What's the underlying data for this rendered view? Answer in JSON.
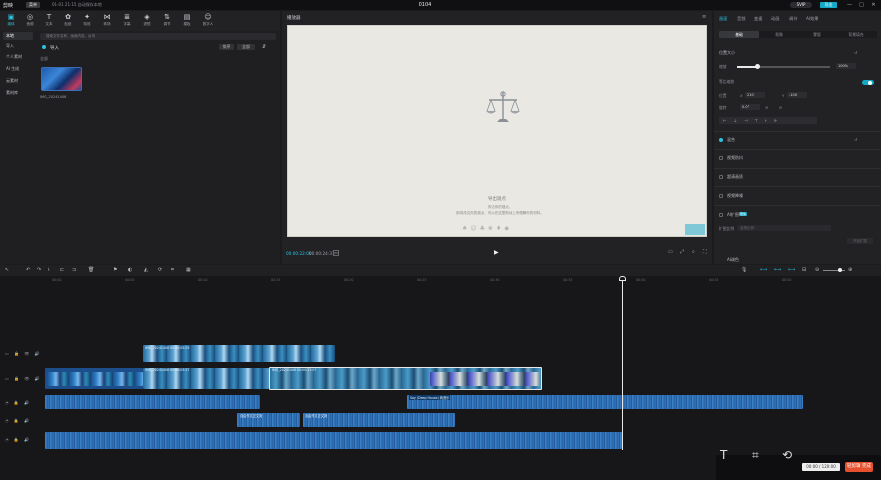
{
  "titlebar": {
    "logo": "剪映",
    "menu": "菜单",
    "autosave": "01-01 21:15 自动保存本地",
    "project_title": "0104",
    "vip": "SVIP",
    "export": "导出",
    "controls": [
      "—",
      "□",
      "✕"
    ]
  },
  "media_tools": [
    {
      "icon": "media-icon",
      "glyph": "▣",
      "label": "媒体"
    },
    {
      "icon": "audio-icon",
      "glyph": "◎",
      "label": "音频"
    },
    {
      "icon": "text-icon",
      "glyph": "T",
      "label": "文本"
    },
    {
      "icon": "sticker-icon",
      "glyph": "✿",
      "label": "贴纸"
    },
    {
      "icon": "effect-icon",
      "glyph": "✦",
      "label": "特效"
    },
    {
      "icon": "transition-icon",
      "glyph": "⋈",
      "label": "转场"
    },
    {
      "icon": "caption-icon",
      "glyph": "≣",
      "label": "字幕"
    },
    {
      "icon": "filter-icon",
      "glyph": "◈",
      "label": "滤镜"
    },
    {
      "icon": "adjust-icon",
      "glyph": "⇅",
      "label": "调节"
    },
    {
      "icon": "template-icon",
      "glyph": "▤",
      "label": "模板"
    },
    {
      "icon": "digital-human-icon",
      "glyph": "☺",
      "label": "数字人"
    }
  ],
  "side_nav": [
    "本地",
    "导入",
    "个人素材",
    "AI 生成",
    "云素材",
    "素材库"
  ],
  "media": {
    "search_placeholder": "搜索文件名称、画面内容、台词",
    "import_label": "导入",
    "sort_label": "排序",
    "filter_label": "全部",
    "section_label": "全部",
    "thumb_name": "IMG_20241406"
  },
  "player": {
    "title": "播放器",
    "empty_title": "导出观点",
    "empty_sub": "传达你的观点。",
    "empty_sub2": "即将传达你的观点，可以在这里拖动上来理解你的材料。",
    "time_current": "00:00:22:06",
    "time_total": "00:00:24:31",
    "hd": "HD",
    "play": "▶"
  },
  "inspector": {
    "tabs": [
      "画面",
      "音频",
      "变速",
      "动画",
      "调节",
      "AI效果"
    ],
    "subtabs": [
      "基础",
      "抠像",
      "蒙版",
      "背景填充"
    ],
    "position_size": "位置大小",
    "scale": "缩放",
    "scale_value": "100%",
    "uniform": "等比缩放",
    "position": "位置",
    "x_label": "X",
    "x_value": "210",
    "y_label": "Y",
    "y_value": "-100",
    "rotate": "旋转",
    "rotate_value": "0.0°",
    "blend": "混合",
    "stabilize": "视频防抖",
    "super_res": "超清画质",
    "denoise": "视频降噪",
    "ai_expand": "AI扩图",
    "ai_badge": "限免",
    "expand_label": "扩图比例",
    "expand_placeholder": "选择比例",
    "expand_btn": "开始扩图",
    "ai_bg": "AI调色"
  },
  "timeline": {
    "ticks": [
      "00:00",
      "00:05",
      "00:10",
      "00:15",
      "00:20",
      "00:25",
      "00:30",
      "00:35",
      "00:40",
      "00:45",
      "00:50"
    ],
    "clip_v1_title": "IMG_20241406  00:00:05:03",
    "clip_main_a": "IMG_20241406  00:00:03:27",
    "clip_main_b": "IMG_20241406  00:00:11:07",
    "audio_title": "Say (Deep House)  纯音乐",
    "audio_clip_a": "自由作文正文篇",
    "audio_clip_b": "自由作文正文篇"
  },
  "taskbar": {
    "time": "00:00 / 120:00",
    "action": "轻剪辑 完成"
  }
}
